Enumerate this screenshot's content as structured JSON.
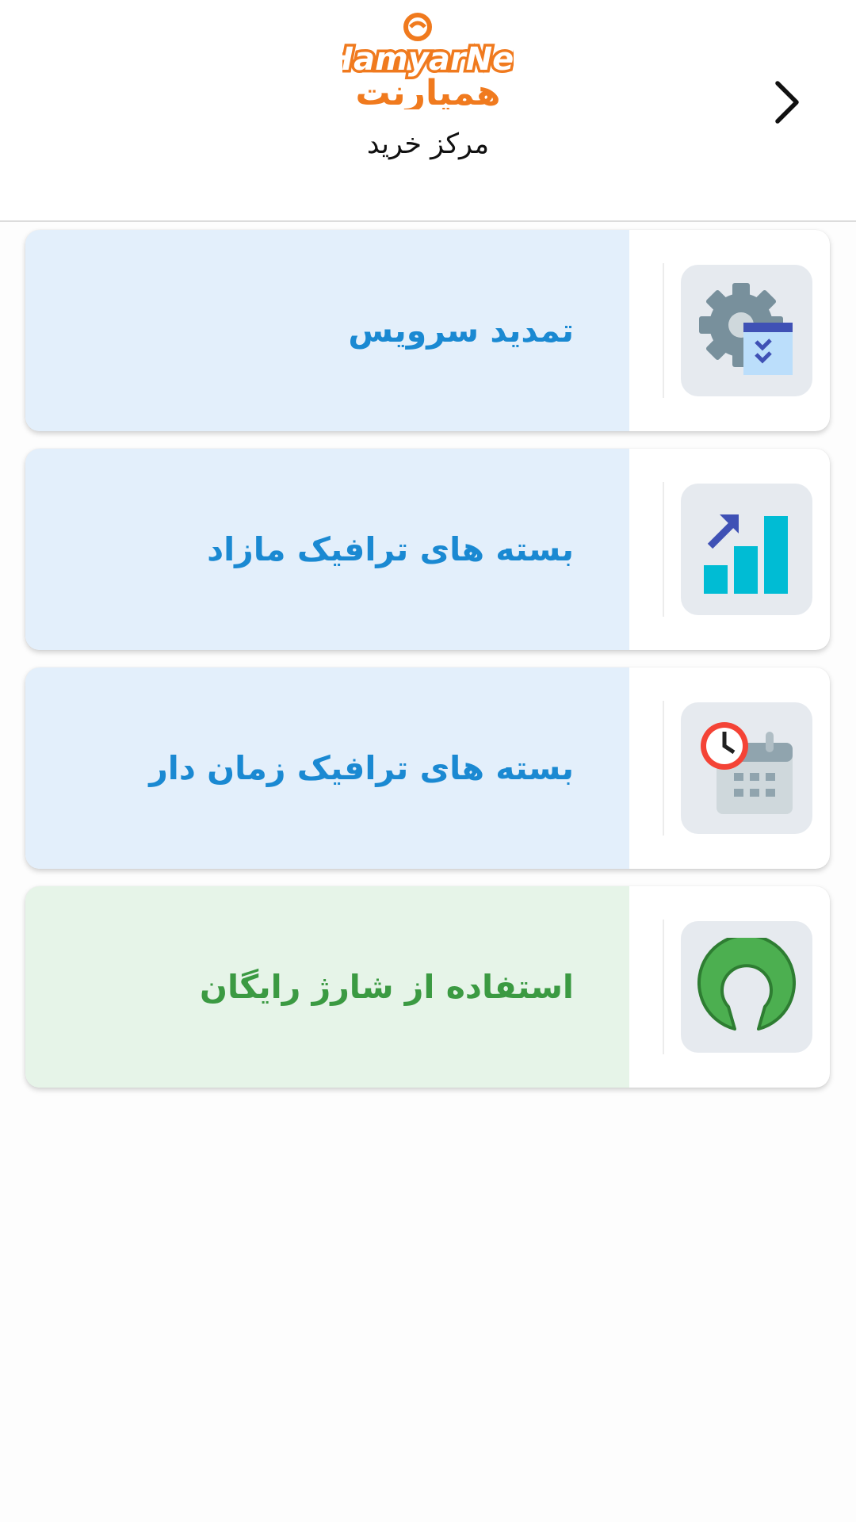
{
  "header": {
    "logo_text_latin": "HamyarNet",
    "logo_text_persian": "همیارنت",
    "title": "مرکز خرید",
    "back_icon": "chevron-right-icon"
  },
  "menu": {
    "items": [
      {
        "label": "تمدید سرویس",
        "icon": "gear-calendar-icon",
        "color": "#1a89d2",
        "background": "#e3effb"
      },
      {
        "label": "بسته های ترافیک مازاد",
        "icon": "bar-chart-growth-icon",
        "color": "#1a89d2",
        "background": "#e3effb"
      },
      {
        "label": "بسته های ترافیک زمان دار",
        "icon": "clock-calendar-icon",
        "color": "#1a89d2",
        "background": "#e3effb"
      },
      {
        "label": "استفاده از شارژ رایگان",
        "icon": "open-source-icon",
        "color": "#3b9a42",
        "background": "#e6f4e8"
      }
    ]
  },
  "colors": {
    "brand_orange": "#f07a1e",
    "item_blue": "#1a89d2",
    "item_green": "#3b9a42"
  }
}
